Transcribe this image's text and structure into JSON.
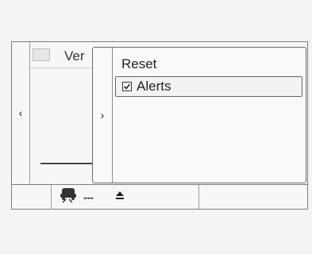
{
  "background_view": {
    "title_partial": "Ver",
    "left_nav_icon": "chevron-left-icon"
  },
  "popup_menu": {
    "back_icon": "chevron-right-icon",
    "items": [
      {
        "label": "Reset"
      },
      {
        "label": "Alerts",
        "checked": true,
        "selected": true
      }
    ]
  },
  "bottom_bar": {
    "items": [
      {
        "icon": "driver-assist-icon",
        "status": "---"
      },
      {
        "icon": "eject-icon"
      }
    ]
  }
}
